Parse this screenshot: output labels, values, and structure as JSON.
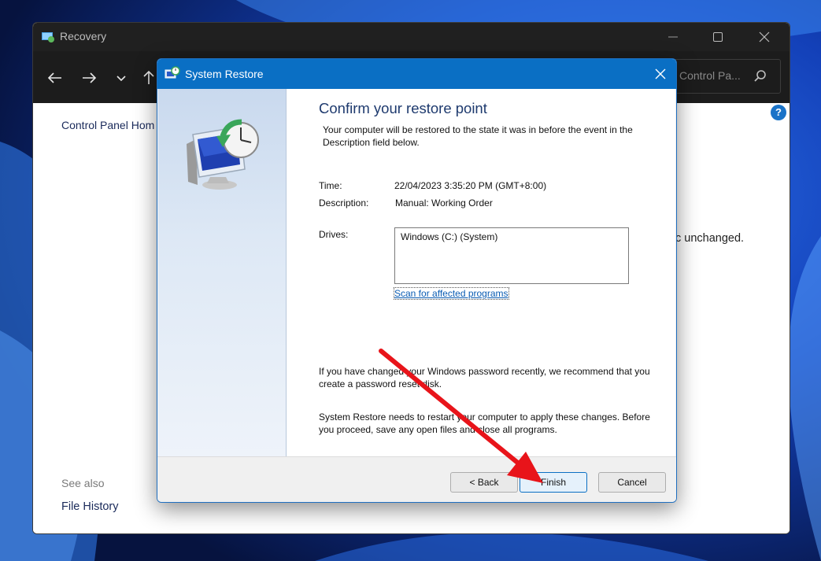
{
  "recovery_window": {
    "title": "Recovery",
    "search_placeholder": "Control Pa...",
    "control_panel_home": "Control Panel Hom",
    "background_text": "c unchanged.",
    "see_also": "See also",
    "file_history": "File History",
    "help": "?"
  },
  "dialog": {
    "title": "System Restore",
    "heading": "Confirm your restore point",
    "description": "Your computer will be restored to the state it was in before the event in the Description field below.",
    "time_label": "Time:",
    "time_value": "22/04/2023 3:35:20 PM (GMT+8:00)",
    "description_label": "Description:",
    "description_value": "Manual: Working Order",
    "drives_label": "Drives:",
    "drives": [
      "Windows (C:) (System)"
    ],
    "scan_link": "Scan for affected programs",
    "password_note": "If you have changed your Windows password recently, we recommend that you create a password reset disk.",
    "restart_note": "System Restore needs to restart your computer to apply these changes. Before you proceed, save any open files and close all programs.",
    "back_button": "< Back",
    "finish_button": "Finish",
    "cancel_button": "Cancel"
  },
  "colors": {
    "dialog_titlebar": "#0a6fc4",
    "annotation_arrow": "#e8141a",
    "link": "#0a5cb3"
  },
  "icons": [
    "recovery-icon",
    "minimize-icon",
    "maximize-icon",
    "close-icon",
    "back-arrow-icon",
    "forward-arrow-icon",
    "recent-chevron-icon",
    "up-arrow-icon",
    "search-icon",
    "help-icon",
    "system-restore-icon",
    "annotation-arrow"
  ]
}
